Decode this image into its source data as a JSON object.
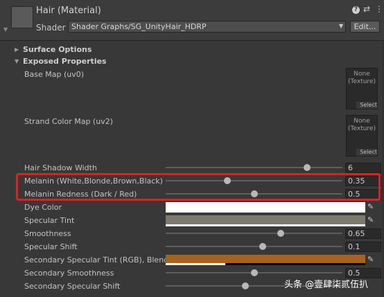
{
  "header": {
    "title": "Hair (Material)",
    "shader_label": "Shader",
    "shader_value": "Shader Graphs/SG_UnityHair_HDRP",
    "edit_label": "Edit...",
    "icons": [
      "help-icon",
      "preset-icon",
      "menu-icon"
    ]
  },
  "sections": {
    "surface_options": "Surface Options",
    "exposed_properties": "Exposed Properties"
  },
  "textures": [
    {
      "label": "Base Map (uv0)",
      "value_line1": "None",
      "value_line2": "(Texture)",
      "select": "Select"
    },
    {
      "label": "Strand Color Map (uv2)",
      "value_line1": "None",
      "value_line2": "(Texture)",
      "select": "Select"
    }
  ],
  "properties": {
    "hair_shadow_width": {
      "label": "Hair Shadow Width",
      "value": "6",
      "level": 0.8
    },
    "melanin": {
      "label": "Melanin (White,Blonde,Brown,Black)",
      "value": "0.35",
      "level": 0.35
    },
    "melanin_redness": {
      "label": "Melanin Redness (Dark / Red)",
      "value": "0.5",
      "level": 0.5
    },
    "dye_color": {
      "label": "Dye Color",
      "color": "#ffffff"
    },
    "specular_tint": {
      "label": "Specular Tint",
      "color": "#7b7a6f"
    },
    "smoothness": {
      "label": "Smoothness",
      "value": "0.65",
      "level": 0.65
    },
    "specular_shift": {
      "label": "Specular Shift",
      "value": "0.1",
      "level": 0.55
    },
    "secondary_specular_tint": {
      "label": "Secondary Specular Tint (RGB), Blend",
      "color": "#a7631d"
    },
    "secondary_smoothness": {
      "label": "Secondary Smoothness",
      "value": "0.5",
      "level": 0.5
    },
    "secondary_specular_shift": {
      "label": "Secondary Specular Shift",
      "value": "",
      "level": 0.45
    }
  },
  "watermark": "头条 @壹肆柒贰伍扒",
  "colors": {
    "highlight": "#e02020",
    "background": "#383838"
  }
}
